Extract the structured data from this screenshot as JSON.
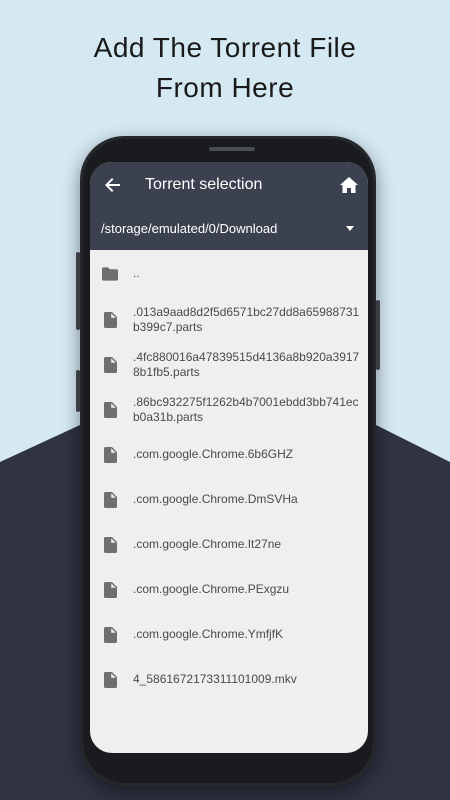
{
  "headline": {
    "line1": "Add The Torrent File",
    "line2": "From Here"
  },
  "colors": {
    "sky": "#d5e9f3",
    "navy": "#2f3342",
    "toolbar": "#3c4150",
    "screen_bg": "#efefef",
    "icon_gray": "#6f6f6f"
  },
  "toolbar": {
    "back_icon": "arrow-back-icon",
    "title": "Torrent selection",
    "home_icon": "home-icon"
  },
  "path_selector": {
    "value": "/storage/emulated/0/Download",
    "caret_icon": "dropdown-caret-icon"
  },
  "entries": [
    {
      "type": "folder",
      "icon": "folder-icon",
      "name": ".."
    },
    {
      "type": "file",
      "icon": "file-icon",
      "name": ".013a9aad8d2f5d6571bc27dd8a65988731b399c7.parts"
    },
    {
      "type": "file",
      "icon": "file-icon",
      "name": ".4fc880016a47839515d4136a8b920a39178b1fb5.parts"
    },
    {
      "type": "file",
      "icon": "file-icon",
      "name": ".86bc932275f1262b4b7001ebdd3bb741ecb0a31b.parts"
    },
    {
      "type": "file",
      "icon": "file-icon",
      "name": ".com.google.Chrome.6b6GHZ"
    },
    {
      "type": "file",
      "icon": "file-icon",
      "name": ".com.google.Chrome.DmSVHa"
    },
    {
      "type": "file",
      "icon": "file-icon",
      "name": ".com.google.Chrome.It27ne"
    },
    {
      "type": "file",
      "icon": "file-icon",
      "name": ".com.google.Chrome.PExgzu"
    },
    {
      "type": "file",
      "icon": "file-icon",
      "name": ".com.google.Chrome.YmfjfK"
    },
    {
      "type": "file",
      "icon": "file-icon",
      "name": "4_5861672173311101009.mkv"
    }
  ]
}
